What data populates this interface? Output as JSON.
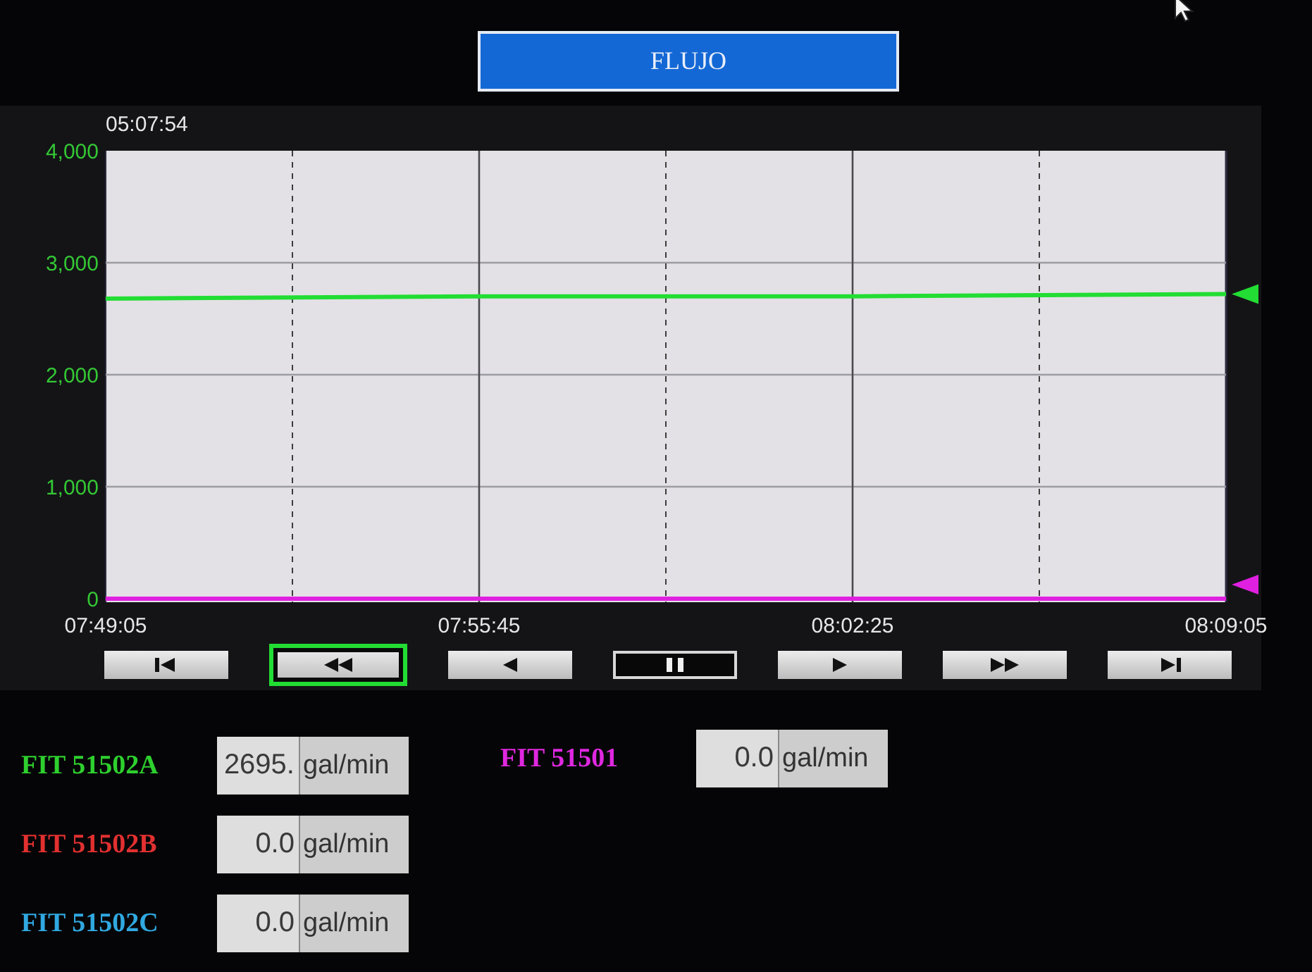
{
  "title_banner": {
    "label": "FLUJO"
  },
  "chart": {
    "time_label": "05:07:54",
    "chart_data": {
      "type": "line",
      "categories": [
        "07:49:05",
        "07:55:45",
        "08:02:25",
        "08:09:05"
      ],
      "series": [
        {
          "color": "#22dd33",
          "values": [
            2680,
            2700,
            2700,
            2720
          ]
        },
        {
          "color": "#e020e0",
          "values": [
            0,
            0,
            0,
            0
          ]
        }
      ],
      "ylim": [
        0,
        4000
      ],
      "yticks": [
        {
          "value": 0,
          "label": "0"
        },
        {
          "value": 1000,
          "label": "1,000"
        },
        {
          "value": 2000,
          "label": "2,000"
        },
        {
          "value": 3000,
          "label": "3,000"
        },
        {
          "value": 4000,
          "label": "4,000"
        }
      ],
      "grid": true
    }
  },
  "playback_buttons": [
    {
      "kind": "skip_start",
      "selected": false,
      "pressed": false
    },
    {
      "kind": "rewind",
      "selected": true,
      "pressed": false
    },
    {
      "kind": "step_back",
      "selected": false,
      "pressed": false
    },
    {
      "kind": "pause",
      "selected": false,
      "pressed": true
    },
    {
      "kind": "play",
      "selected": false,
      "pressed": false
    },
    {
      "kind": "fast_forward",
      "selected": false,
      "pressed": false
    },
    {
      "kind": "skip_end",
      "selected": false,
      "pressed": false
    }
  ],
  "reading_columns": [
    {
      "readings": [
        {
          "tag": "FIT 51502A",
          "value": "2695.",
          "unit": "gal/min",
          "color": "#2ed02e"
        },
        {
          "tag": "FIT 51502B",
          "value": "0.0",
          "unit": "gal/min",
          "color": "#e23030"
        },
        {
          "tag": "FIT 51502C",
          "value": "0.0",
          "unit": "gal/min",
          "color": "#30a8e0"
        }
      ]
    },
    {
      "readings": [
        {
          "tag": "FIT 51501",
          "value": "0.0",
          "unit": "gal/min",
          "color": "#e028e0"
        }
      ]
    }
  ]
}
